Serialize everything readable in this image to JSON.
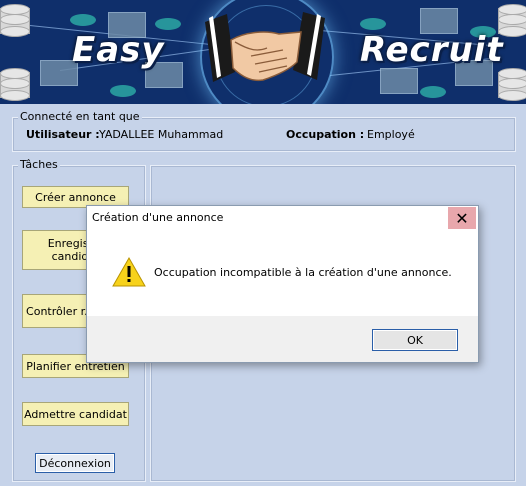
{
  "banner": {
    "word_left": "Easy",
    "word_right": "Recruit"
  },
  "session": {
    "group_label": "Connecté en tant que",
    "user_label": "Utilisateur :",
    "user_value": "YADALLEE Muhammad",
    "occupation_label": "Occupation :",
    "occupation_value": "Employé"
  },
  "tasks": {
    "group_label": "Tâches",
    "create": "Créer annonce",
    "register": "Enregist... candidat",
    "control": "Contrôler r... tests",
    "plan": "Planifier entretien",
    "admit": "Admettre candidat",
    "logout": "Déconnexion"
  },
  "dialog": {
    "title": "Création d'une annonce",
    "message": "Occupation incompatible à la création d'une annonce.",
    "ok": "OK",
    "close_glyph": "✕"
  }
}
